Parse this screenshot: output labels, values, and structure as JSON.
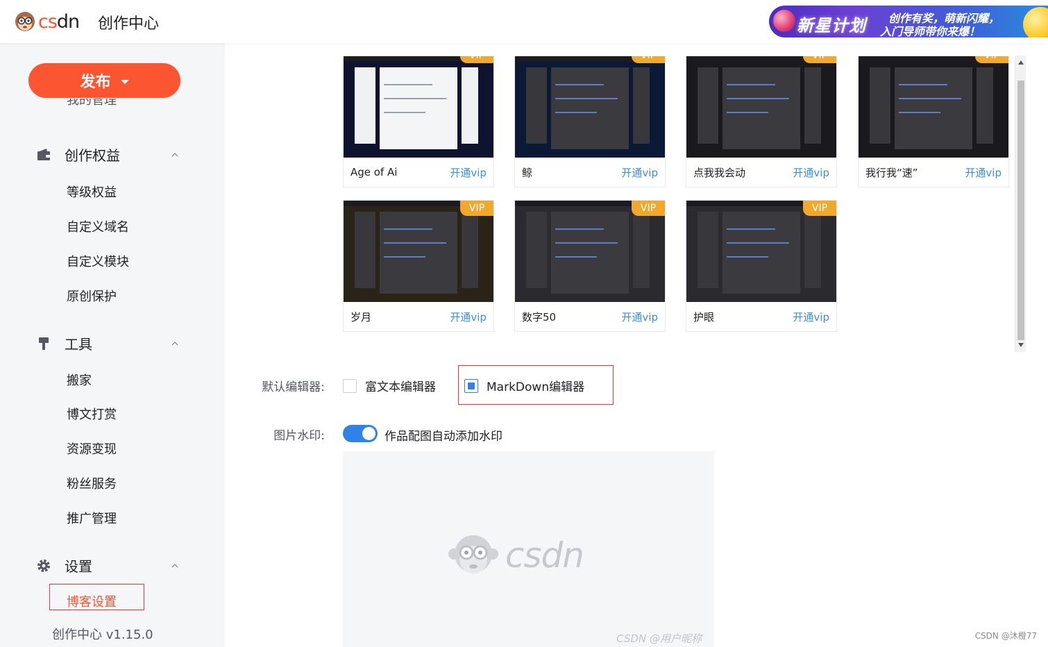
{
  "header": {
    "logo_text_cs": "cs",
    "logo_text_dn": "dn",
    "title": "创作中心",
    "banner_main": "新星计划",
    "banner_sub1": "创作有奖，萌新闪耀，",
    "banner_sub2": "入门导师带你来爆！"
  },
  "sidebar": {
    "publish_label": "发布",
    "clipped_item": "我的管理",
    "sections": [
      {
        "label": "创作权益",
        "items": [
          "等级权益",
          "自定义域名",
          "自定义模块",
          "原创保护"
        ]
      },
      {
        "label": "工具",
        "items": [
          "搬家",
          "博文打赏",
          "资源变现",
          "粉丝服务",
          "推广管理"
        ]
      },
      {
        "label": "设置",
        "items": [
          "博客设置"
        ]
      }
    ],
    "version": "创作中心 v1.15.0"
  },
  "skins": {
    "vip_badge": "VIP",
    "open_vip": "开通vip",
    "cards": [
      {
        "name": "Age of Ai"
      },
      {
        "name": "鲸"
      },
      {
        "name": "点我我会动"
      },
      {
        "name": "我行我“速”"
      },
      {
        "name": "岁月"
      },
      {
        "name": "数字50"
      },
      {
        "name": "护眼"
      }
    ]
  },
  "editor": {
    "label": "默认编辑器:",
    "options": [
      "富文本编辑器",
      "MarkDown编辑器"
    ],
    "selected": "MarkDown编辑器"
  },
  "watermark": {
    "label": "图片水印:",
    "toggle_on": true,
    "toggle_label": "作品配图自动添加水印",
    "preview_logo_text": "csdn",
    "preview_footer": "CSDN @用户昵称"
  },
  "corner_mark": "CSDN @沐橙77",
  "colors": {
    "brand": "#fc5531",
    "link": "#3b8fd6",
    "toggle": "#2f82e6",
    "vip": "#f0a92c",
    "sidebar_bg": "#f5f6f7"
  }
}
